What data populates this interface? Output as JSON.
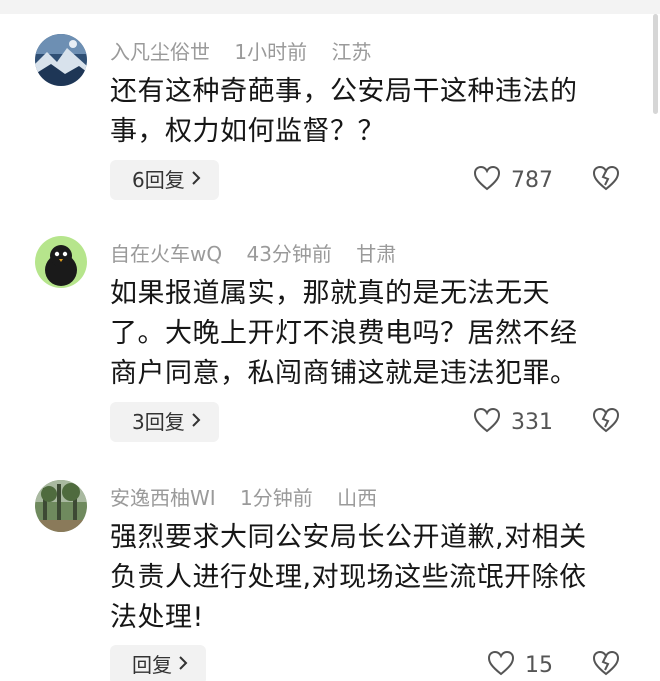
{
  "comments": [
    {
      "username": "入凡尘俗世",
      "time": "1小时前",
      "location": "江苏",
      "text_lines": [
        "还有这种奇葩事，公安局干这种违法的",
        "事，权力如何监督？？"
      ],
      "reply_label": "6回复",
      "likes": "787",
      "avatar": "blue-landscape-avatar"
    },
    {
      "username": "自在火车wQ",
      "time": "43分钟前",
      "location": "甘肃",
      "text_lines": [
        "如果报道属实，那就真的是无法无天",
        "了。大晚上开灯不浪费电吗？居然不经",
        "商户同意，私闯商铺这就是违法犯罪。"
      ],
      "reply_label": "3回复",
      "likes": "331",
      "avatar": "black-bird-avatar"
    },
    {
      "username": "安逸西柚WI",
      "time": "1分钟前",
      "location": "山西",
      "text_lines": [
        "强烈要求大同公安局长公开道歉,对相关",
        "负责人进行处理,对现场这些流氓开除依",
        "法处理!"
      ],
      "reply_label": "回复",
      "likes": "15",
      "avatar": "garden-photo-avatar"
    }
  ],
  "colors": {
    "meta": "#9a9a9a",
    "text": "#161616",
    "reply_bg": "#f2f2f2"
  }
}
